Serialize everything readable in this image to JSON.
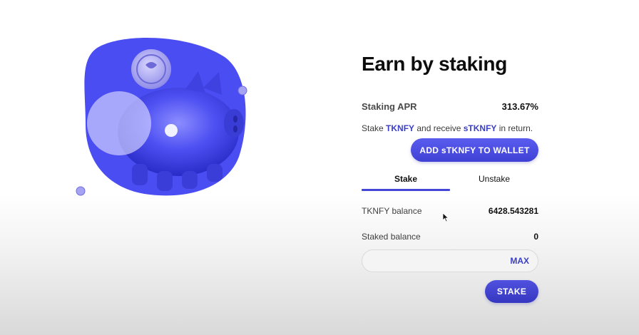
{
  "hero": {
    "illustration_icon": "piggy-bank-with-coin",
    "accent_color": "#4b4ef0"
  },
  "panel": {
    "title": "Earn by staking",
    "apr_label": "Staking APR",
    "apr_value": "313.67%",
    "stake_text_prefix": "Stake ",
    "stake_token": "TKNFY",
    "stake_text_middle": " and receive ",
    "receive_token": "sTKNFY",
    "stake_text_suffix": " in return.",
    "add_wallet_button": "ADD sTKNFY TO WALLET",
    "tabs": [
      {
        "label": "Stake",
        "active": true
      },
      {
        "label": "Unstake",
        "active": false
      }
    ],
    "balances": [
      {
        "label": "TKNFY balance",
        "value": "6428.543281"
      },
      {
        "label": "Staked balance",
        "value": "0"
      }
    ],
    "amount_input": {
      "value": "",
      "placeholder": ""
    },
    "max_button": "MAX",
    "stake_button": "STAKE"
  },
  "colors": {
    "primary": "#4346d6",
    "token_text": "#3b3fc4"
  }
}
